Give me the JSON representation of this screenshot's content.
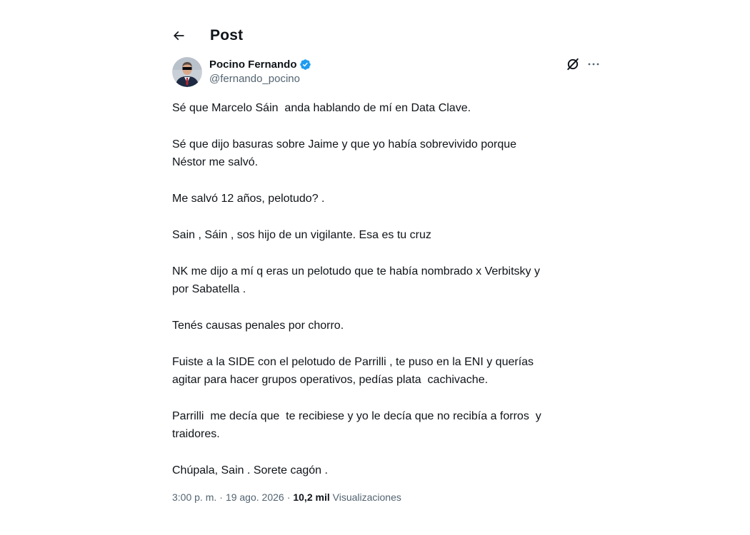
{
  "header": {
    "title": "Post",
    "back_icon": "arrow-left-icon"
  },
  "author": {
    "display_name": "Pocino Fernando",
    "handle": "@fernando_pocino",
    "verified": true,
    "verified_color": "#1d9bf0",
    "avatar_icon": "avatar-photo"
  },
  "actions": {
    "grok_icon": "grok-slash-circle-icon",
    "more_icon": "more-horizontal-icon"
  },
  "post": {
    "paragraphs": [
      "Sé que Marcelo Sáin  anda hablando de mí en Data Clave.",
      "Sé que dijo basuras sobre Jaime y que yo había sobrevivido porque\nNéstor me salvó.",
      "Me salvó 12 años, pelotudo? .",
      "Sain , Sáin , sos hijo de un vigilante. Esa es tu cruz",
      "NK me dijo a mí q eras un pelotudo que te había nombrado x Verbitsky y\npor Sabatella .",
      "Tenés causas penales por chorro.",
      "Fuiste a la SIDE con el pelotudo de Parrilli , te puso en la ENI y querías\nagitar para hacer grupos operativos, pedías plata  cachivache.",
      "Parrilli  me decía que  te recibiese y yo le decía que no recibía a forros  y\ntraidores.",
      "Chúpala, Sain . Sorete cagón ."
    ]
  },
  "meta": {
    "time": "3:00 p. m.",
    "separator": "·",
    "date": "19 ago. 2026",
    "views_count": "10,2 mil",
    "views_label": "Visualizaciones"
  },
  "colors": {
    "text": "#0f1419",
    "secondary": "#536471",
    "accent": "#1d9bf0"
  }
}
